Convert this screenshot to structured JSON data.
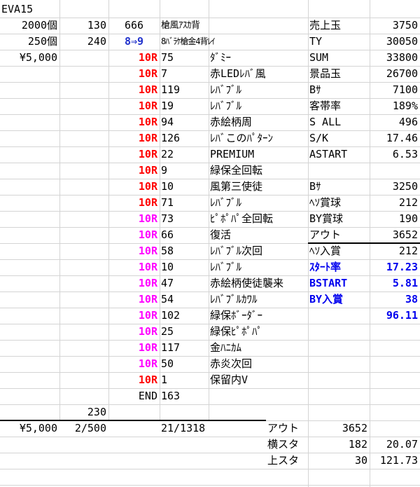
{
  "sheet": {
    "title": "EVA15",
    "top_left": {
      "a2": "2000個",
      "b2": "130",
      "c2": "666",
      "d2": "槍風ｱｽｶ背",
      "a3": "250個",
      "b3": "240",
      "c3": "8⇒9",
      "d3": "8ﾊﾞﾗｹ槍金4背ﾚｲ",
      "a4": "¥5,000"
    },
    "rounds": [
      {
        "r": "10R",
        "color": "red",
        "n": "75",
        "name": "ﾀﾞﾐｰ"
      },
      {
        "r": "10R",
        "color": "red",
        "n": "7",
        "name": "赤LEDﾚﾊﾞ風"
      },
      {
        "r": "10R",
        "color": "red",
        "n": "119",
        "name": "ﾚﾊﾞﾌﾞﾙ"
      },
      {
        "r": "10R",
        "color": "red",
        "n": "19",
        "name": "ﾚﾊﾞﾌﾞﾙ"
      },
      {
        "r": "10R",
        "color": "red",
        "n": "94",
        "name": "赤絵柄周"
      },
      {
        "r": "10R",
        "color": "red",
        "n": "126",
        "name": "ﾚﾊﾞこのﾊﾟﾀｰﾝ"
      },
      {
        "r": "10R",
        "color": "red",
        "n": "22",
        "name": "PREMIUM"
      },
      {
        "r": "10R",
        "color": "red",
        "n": "9",
        "name": "緑保全回転"
      },
      {
        "r": "10R",
        "color": "red",
        "n": "10",
        "name": "風第三使徒"
      },
      {
        "r": "10R",
        "color": "red",
        "n": "71",
        "name": "ﾚﾊﾞﾌﾞﾙ"
      },
      {
        "r": "10R",
        "color": "mag",
        "n": "73",
        "name": "ﾋﾟﾎﾟﾊﾟ全回転"
      },
      {
        "r": "10R",
        "color": "mag",
        "n": "66",
        "name": "復活"
      },
      {
        "r": "10R",
        "color": "mag",
        "n": "58",
        "name": "ﾚﾊﾞﾌﾞﾙ次回"
      },
      {
        "r": "10R",
        "color": "mag",
        "n": "10",
        "name": "ﾚﾊﾞﾌﾞﾙ"
      },
      {
        "r": "10R",
        "color": "mag",
        "n": "47",
        "name": "赤絵柄使徒襲来"
      },
      {
        "r": "10R",
        "color": "mag",
        "n": "54",
        "name": "ﾚﾊﾞﾌﾞﾙｶﾜﾙ"
      },
      {
        "r": "10R",
        "color": "mag",
        "n": "102",
        "name": "緑保ﾎﾞｰﾀﾞｰ"
      },
      {
        "r": "10R",
        "color": "mag",
        "n": "25",
        "name": "緑保ﾋﾟﾎﾟﾊﾟ"
      },
      {
        "r": "10R",
        "color": "mag",
        "n": "117",
        "name": "金ﾊﾆｶﾑ"
      },
      {
        "r": "10R",
        "color": "mag",
        "n": "50",
        "name": "赤炎次回"
      },
      {
        "r": "10R",
        "color": "red",
        "n": "1",
        "name": "保留内V"
      },
      {
        "r": "END",
        "color": "black",
        "n": "163",
        "name": ""
      }
    ],
    "stats": [
      {
        "label": "売上玉",
        "value": "3750",
        "style": "normal"
      },
      {
        "label": "TY",
        "value": "30050",
        "style": "normal"
      },
      {
        "label": "SUM",
        "value": "33800",
        "style": "normal"
      },
      {
        "label": "景品玉",
        "value": "26700",
        "style": "normal"
      },
      {
        "label": "Bｻ",
        "value": "7100",
        "style": "normal"
      },
      {
        "label": "客帯率",
        "value": "189%",
        "style": "normal"
      },
      {
        "label": "S ALL",
        "value": "496",
        "style": "normal"
      },
      {
        "label": "S/K",
        "value": "17.46",
        "style": "normal"
      },
      {
        "label": "ASTART",
        "value": "6.53",
        "style": "normal"
      },
      {
        "label": "",
        "value": "",
        "style": "normal"
      },
      {
        "label": "Bｻ",
        "value": "3250",
        "style": "normal"
      },
      {
        "label": "ﾍｿ賞球",
        "value": "212",
        "style": "normal"
      },
      {
        "label": "BY賞球",
        "value": "190",
        "style": "normal"
      },
      {
        "label": "アウト",
        "value": "3652",
        "style": "normal"
      },
      {
        "label": "ﾍｿ入賞",
        "value": "212",
        "style": "normal"
      },
      {
        "label": "ｽﾀｰﾄ率",
        "value": "17.23",
        "style": "blue"
      },
      {
        "label": "BSTART",
        "value": "5.81",
        "style": "blue"
      },
      {
        "label": "BY入賞",
        "value": "38",
        "style": "blue"
      },
      {
        "label": "",
        "value": "96.11",
        "style": "blue"
      }
    ],
    "b27": "230",
    "footer": {
      "a": "¥5,000",
      "b": "2/500",
      "d": "21/1318",
      "rows": [
        {
          "label": "アウト",
          "v1": "3652",
          "v2": ""
        },
        {
          "label": "横スタ",
          "v1": "182",
          "v2": "20.07"
        },
        {
          "label": "上スタ",
          "v1": "30",
          "v2": "121.73"
        }
      ]
    }
  }
}
